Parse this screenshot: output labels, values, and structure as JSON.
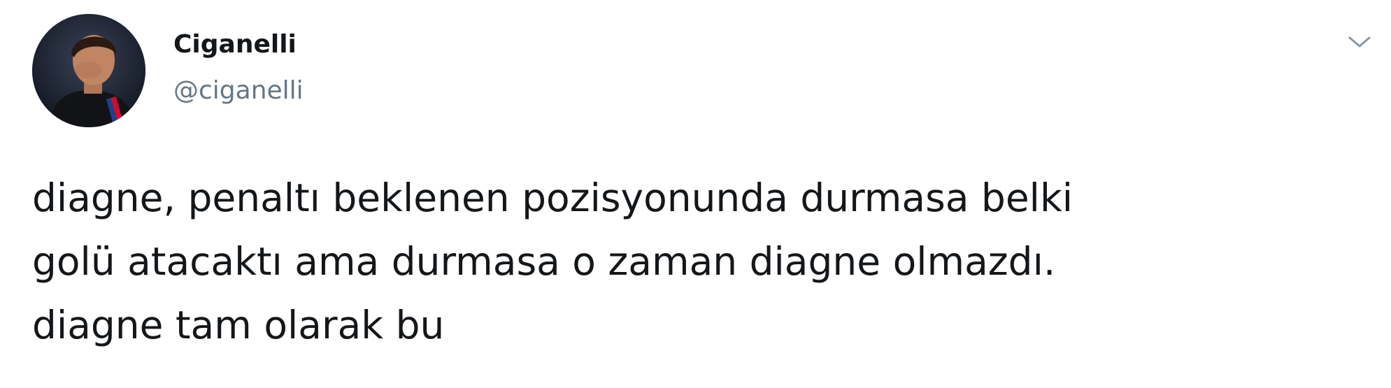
{
  "tweet": {
    "author": {
      "display_name": "Ciganelli",
      "handle": "@ciganelli",
      "avatar_icon": "profile-photo"
    },
    "menu_icon": "chevron-down-icon",
    "text_lines": [
      "diagne, penaltı beklenen pozisyonunda durmasa belki",
      "golü atacaktı ama durmasa o zaman diagne olmazdı.",
      "diagne tam olarak bu"
    ]
  },
  "colors": {
    "text_primary": "#14171a",
    "text_secondary": "#657786",
    "icon": "#8899a6",
    "background": "#ffffff"
  }
}
